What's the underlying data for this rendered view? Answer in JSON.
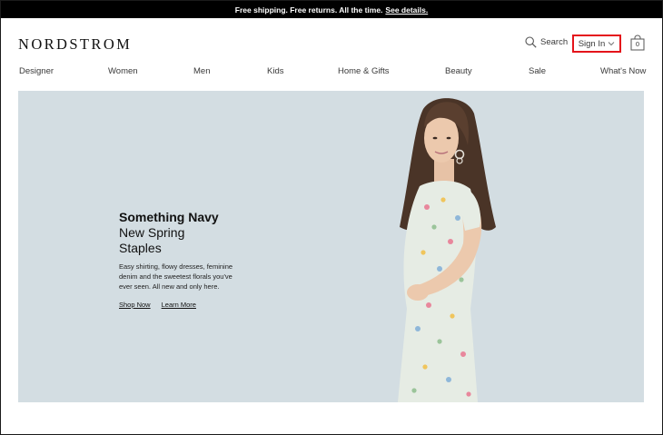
{
  "promo": {
    "text": "Free shipping. Free returns. All the time.",
    "link": "See details."
  },
  "header": {
    "logo": "NORDSTROM",
    "search_label": "Search",
    "signin_label": "Sign In",
    "bag_count": "0",
    "icons": {
      "search": "search-icon",
      "signin": "chevron-down-icon",
      "bag": "shopping-bag-icon"
    },
    "highlight_color": "#e4141b"
  },
  "nav": {
    "items": [
      {
        "label": "Designer"
      },
      {
        "label": "Women"
      },
      {
        "label": "Men"
      },
      {
        "label": "Kids"
      },
      {
        "label": "Home & Gifts"
      },
      {
        "label": "Beauty"
      },
      {
        "label": "Sale"
      },
      {
        "label": "What's Now"
      }
    ]
  },
  "hero": {
    "title": "Something Navy",
    "subtitle_line1": "New Spring",
    "subtitle_line2": "Staples",
    "body": "Easy shirting, flowy dresses, feminine denim and the sweetest florals you've ever seen. All new and only here.",
    "shop_link": "Shop Now",
    "learn_link": "Learn More",
    "background": "#d3dde2"
  }
}
